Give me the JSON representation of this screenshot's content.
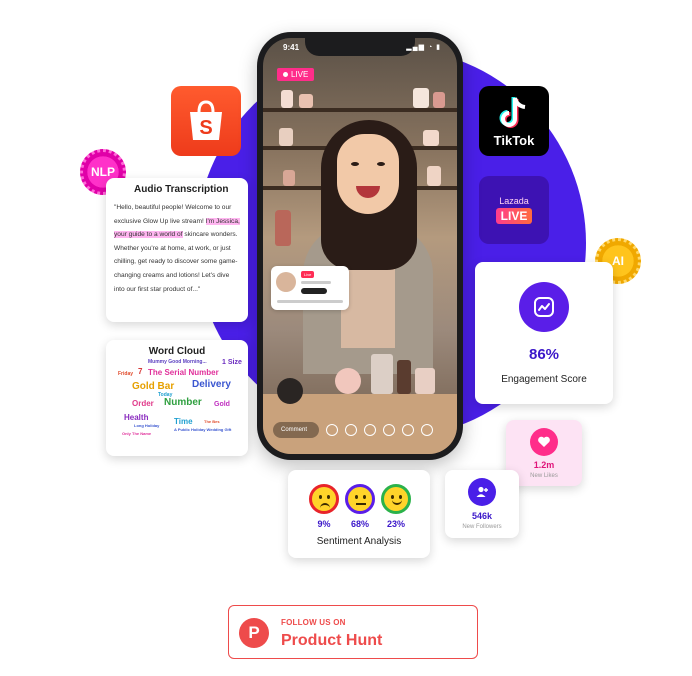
{
  "phone": {
    "time": "9:41",
    "status_icons": "▂▄▆ ◔ ▮",
    "live_badge": "LIVE",
    "comment_placeholder": "Comment",
    "mini_card_live": "Live"
  },
  "logos": {
    "shopee_icon": "shopee-bag-icon",
    "tiktok_word": "TikTok",
    "lazada_word": "Lazada",
    "lazada_live": "LIVE"
  },
  "badges": {
    "nlp": "NLP",
    "ai": "AI"
  },
  "audio_transcription": {
    "title": "Audio Transcription",
    "text_before": "\"Hello, beautiful people! Welcome to our exclusive Glow Up live stream! ",
    "text_highlight": "I'm Jessica, your guide to a world of",
    "text_after": " skincare wonders. Whether you're at home, at work, or just chilling, get ready to discover some game-changing creams and lotions! Let's dive into our first star product of...\""
  },
  "word_cloud": {
    "title": "Word Cloud",
    "words": [
      {
        "text": "Mummy Good Morning...",
        "color": "#5a3fc0"
      },
      {
        "text": "7",
        "color": "#d63a3a"
      },
      {
        "text": "1 Size",
        "color": "#6a2bbf"
      },
      {
        "text": "Friday",
        "color": "#e04a2a"
      },
      {
        "text": "The Serial Number",
        "color": "#e0309a"
      },
      {
        "text": "Gold Bar",
        "color": "#e6a000"
      },
      {
        "text": "Delivery",
        "color": "#3a56d0"
      },
      {
        "text": "Today",
        "color": "#20a0d0"
      },
      {
        "text": "Order",
        "color": "#e03a8a"
      },
      {
        "text": "Number",
        "color": "#30a040"
      },
      {
        "text": "Gold",
        "color": "#c030c0"
      },
      {
        "text": "Health",
        "color": "#8a2bbf"
      },
      {
        "text": "Time",
        "color": "#20a0d0"
      },
      {
        "text": "The Bes",
        "color": "#e04a2a"
      },
      {
        "text": "Long Holiday",
        "color": "#3a56d0"
      },
      {
        "text": "A Public Holiday Wedding Gift",
        "color": "#3a56d0"
      },
      {
        "text": "Only The Name",
        "color": "#e0309a"
      }
    ]
  },
  "engagement": {
    "value": "86%",
    "label": "Engagement Score"
  },
  "likes": {
    "value": "1.2m",
    "label": "New Likes"
  },
  "followers": {
    "value": "546k",
    "label": "New Followers"
  },
  "sentiment": {
    "label": "Sentiment Analysis",
    "items": [
      {
        "pct": "9%",
        "ring": "#e8242a",
        "mood": "sad"
      },
      {
        "pct": "68%",
        "ring": "#5a1ee8",
        "mood": "neutral"
      },
      {
        "pct": "23%",
        "ring": "#2bb24a",
        "mood": "happy"
      }
    ]
  },
  "product_hunt": {
    "small": "FOLLOW US ON",
    "big": "Product Hunt",
    "logo_letter": "P"
  }
}
